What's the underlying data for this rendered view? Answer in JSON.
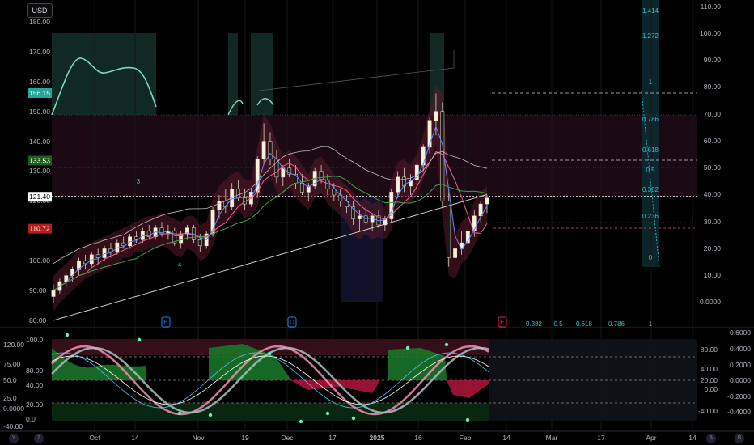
{
  "currency_button": "USD",
  "corner_buttons": {
    "y": "Y",
    "z": "Z",
    "a": "A",
    "b": "B"
  },
  "price_axis_ticks": [
    "180.00",
    "170.00",
    "160.00",
    "150.00",
    "140.00",
    "130.00",
    "120.00",
    "110.00",
    "100.00",
    "90.00",
    "80.00"
  ],
  "price_tags": [
    {
      "label": "156.15",
      "color": "#26a69a",
      "text_color": "#ffffff",
      "price": 156.15
    },
    {
      "label": "133.53",
      "color": "#1b5e20",
      "text_color": "#ffffff",
      "price": 133.53
    },
    {
      "label": "121.40",
      "color": "#ffffff",
      "text_color": "#000000",
      "price": 121.4
    },
    {
      "label": "110.72",
      "color": "#b71c1c",
      "text_color": "#ffffff",
      "price": 110.72
    }
  ],
  "right_axis_ticks": [
    "110.00",
    "100.00",
    "90.00",
    "80.00",
    "70.00",
    "60.00",
    "50.00",
    "40.00",
    "30.00",
    "20.00",
    "10.00",
    "0.0000"
  ],
  "fib_levels": [
    "1.414",
    "1.272",
    "1",
    "0.786",
    "0.618",
    "0.5",
    "0.382",
    "0.236",
    "0"
  ],
  "fib_bottom_labels": [
    "0.382",
    "0.5",
    "0.618",
    "0.786",
    "1"
  ],
  "chart_markers": [
    "3",
    "4"
  ],
  "event_markers": [
    "E",
    "D",
    "E"
  ],
  "lower_left_ticks": [
    "120.00",
    "100.0",
    "75.00",
    "80.00",
    "50.0",
    "40.00",
    "25.0",
    "20.00",
    "0.0000",
    "0.0",
    "-40.00"
  ],
  "lower_right_ticks_a": [
    "80.00",
    "40.00",
    "20.00",
    "0.00",
    "-40.00"
  ],
  "lower_right_ticks_b": [
    "0.6000",
    "0.4000",
    "0.2000",
    "0.0000",
    "-0.2000",
    "-0.4000"
  ],
  "time_axis": [
    "Oct",
    "14",
    "Nov",
    "19",
    "Dec",
    "17",
    "2025",
    "16",
    "Feb",
    "14",
    "Mar",
    "17",
    "Apr",
    "14"
  ],
  "chart_data": {
    "type": "candlestick",
    "ylim": [
      80,
      180
    ],
    "last_price": 121.4,
    "x_labels": [
      "Oct",
      "14",
      "Nov",
      "19",
      "Dec",
      "17",
      "2025",
      "16",
      "Feb",
      "14",
      "Mar",
      "17",
      "Apr",
      "14"
    ],
    "candles": [
      [
        88,
        92,
        86,
        90
      ],
      [
        90,
        94,
        89,
        93
      ],
      [
        93,
        96,
        91,
        95
      ],
      [
        95,
        98,
        93,
        97
      ],
      [
        97,
        101,
        95,
        100
      ],
      [
        100,
        102,
        97,
        99
      ],
      [
        99,
        103,
        98,
        102
      ],
      [
        102,
        104,
        99,
        101
      ],
      [
        101,
        105,
        100,
        104
      ],
      [
        104,
        106,
        101,
        103
      ],
      [
        103,
        107,
        102,
        106
      ],
      [
        106,
        108,
        104,
        105
      ],
      [
        105,
        109,
        104,
        108
      ],
      [
        108,
        110,
        106,
        107
      ],
      [
        107,
        111,
        106,
        110
      ],
      [
        110,
        112,
        107,
        108
      ],
      [
        108,
        112,
        107,
        111
      ],
      [
        111,
        113,
        108,
        109
      ],
      [
        109,
        112,
        107,
        110
      ],
      [
        110,
        111,
        105,
        106
      ],
      [
        106,
        110,
        104,
        109
      ],
      [
        109,
        112,
        107,
        111
      ],
      [
        111,
        112,
        106,
        107
      ],
      [
        107,
        109,
        103,
        105
      ],
      [
        105,
        110,
        104,
        109
      ],
      [
        109,
        118,
        108,
        117
      ],
      [
        117,
        122,
        114,
        120
      ],
      [
        120,
        124,
        116,
        118
      ],
      [
        118,
        126,
        117,
        124
      ],
      [
        124,
        127,
        120,
        121
      ],
      [
        121,
        124,
        117,
        119
      ],
      [
        119,
        124,
        118,
        123
      ],
      [
        123,
        135,
        121,
        134
      ],
      [
        134,
        146,
        132,
        140
      ],
      [
        140,
        143,
        132,
        134
      ],
      [
        134,
        137,
        126,
        128
      ],
      [
        128,
        132,
        125,
        131
      ],
      [
        131,
        134,
        128,
        129
      ],
      [
        129,
        132,
        124,
        126
      ],
      [
        126,
        129,
        122,
        123
      ],
      [
        123,
        126,
        120,
        125
      ],
      [
        125,
        131,
        124,
        130
      ],
      [
        130,
        132,
        126,
        127
      ],
      [
        127,
        129,
        122,
        124
      ],
      [
        124,
        126,
        120,
        122
      ],
      [
        122,
        124,
        118,
        120
      ],
      [
        120,
        122,
        116,
        118
      ],
      [
        118,
        120,
        112,
        114
      ],
      [
        114,
        117,
        110,
        115
      ],
      [
        115,
        118,
        112,
        113
      ],
      [
        113,
        116,
        110,
        115
      ],
      [
        115,
        117,
        111,
        112
      ],
      [
        112,
        115,
        110,
        114
      ],
      [
        114,
        124,
        113,
        123
      ],
      [
        123,
        130,
        121,
        128
      ],
      [
        128,
        131,
        123,
        125
      ],
      [
        125,
        129,
        122,
        127
      ],
      [
        127,
        133,
        125,
        132
      ],
      [
        132,
        139,
        130,
        138
      ],
      [
        138,
        148,
        136,
        147
      ],
      [
        147,
        156,
        142,
        150
      ],
      [
        150,
        153,
        118,
        120
      ],
      [
        120,
        124,
        98,
        101
      ],
      [
        101,
        106,
        97,
        104
      ],
      [
        104,
        110,
        102,
        106
      ],
      [
        106,
        112,
        104,
        110
      ],
      [
        110,
        117,
        108,
        115
      ],
      [
        115,
        120,
        113,
        119
      ],
      [
        119,
        122,
        116,
        121
      ]
    ],
    "series": [
      {
        "name": "",
        "values": []
      }
    ],
    "fib_retracement": [
      1.414,
      1.272,
      1,
      0.786,
      0.618,
      0.5,
      0.382,
      0.236,
      0
    ],
    "oscillator": {
      "ylim": [
        -40,
        120
      ],
      "upper_band": 70,
      "lower_band": 20
    }
  }
}
